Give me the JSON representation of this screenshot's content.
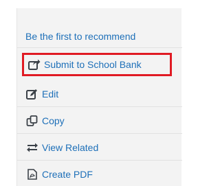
{
  "panel": {
    "recommend_label": "Be the first to recommend",
    "items": [
      {
        "label": "Submit to School Bank",
        "icon": "share-icon"
      },
      {
        "label": "Edit",
        "icon": "edit-icon"
      },
      {
        "label": "Copy",
        "icon": "copy-icon"
      },
      {
        "label": "View Related",
        "icon": "related-icon"
      },
      {
        "label": "Create PDF",
        "icon": "pdf-icon"
      }
    ]
  },
  "colors": {
    "link": "#1d6fb8",
    "highlight_border": "#e01a23",
    "panel_background": "#f3f3f3",
    "icon": "#3b4148"
  }
}
